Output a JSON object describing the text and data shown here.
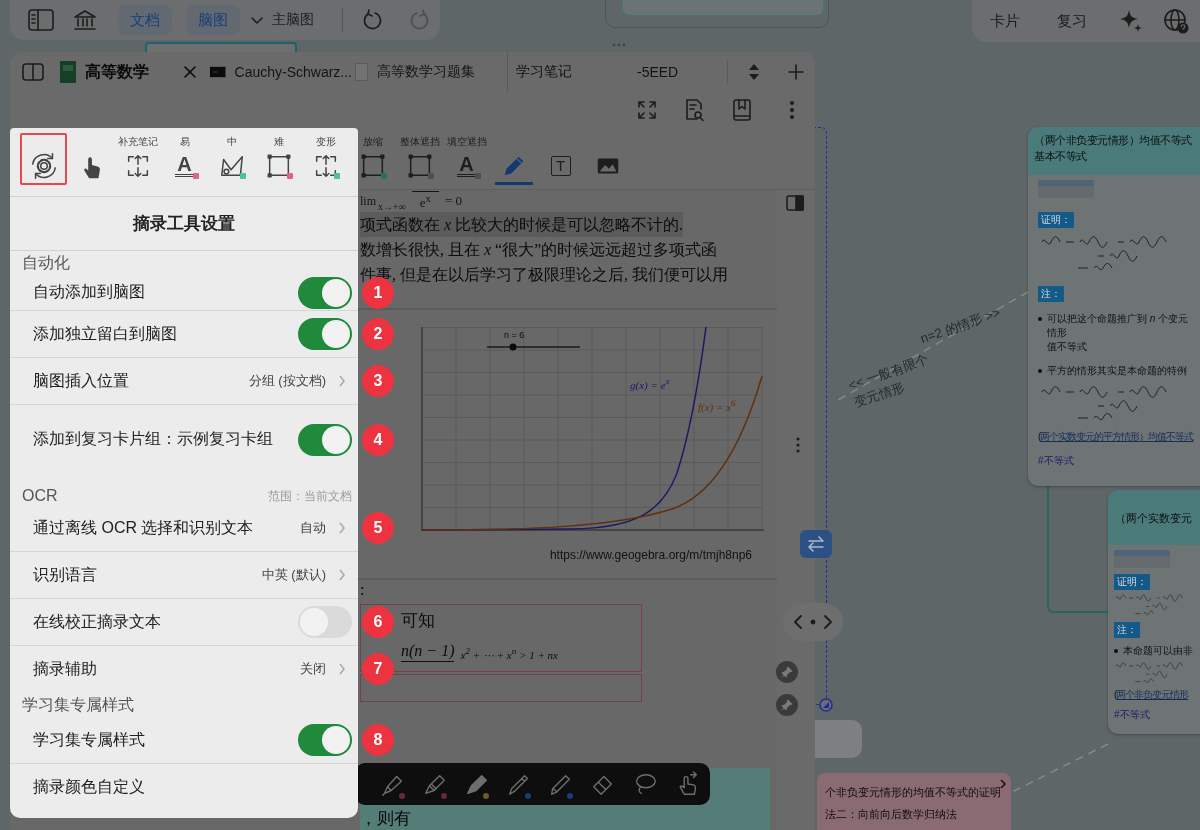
{
  "top_toolbar": {
    "view_buttons": [
      {
        "label": "文档",
        "selected": true
      },
      {
        "label": "脑图",
        "selected": true
      }
    ],
    "mindmap_dropdown": "主脑图",
    "undo": {
      "disabled": false
    },
    "redo": {
      "disabled": true
    }
  },
  "right_toolbar": {
    "buttons": [
      "卡片",
      "复习"
    ]
  },
  "doc_window": {
    "tabs": [
      {
        "label": "高等数学",
        "selected": true,
        "kind": "book"
      },
      {
        "label": "Cauchy-Schwarz...",
        "selected": false,
        "kind": "dark-page"
      },
      {
        "label": "高等数学习题集",
        "selected": false,
        "kind": "blank-page"
      },
      {
        "label": "学习笔记",
        "selected": false,
        "kind": "plain"
      },
      {
        "label": "-5EED",
        "selected": false,
        "kind": "plain"
      }
    ],
    "tools": [
      {
        "kind": "cycle-gear",
        "dimmed": false,
        "selected": false,
        "outlined": true
      },
      {
        "kind": "hand",
        "dimmed": false,
        "selected": false,
        "outlined": false
      },
      {
        "label": "补充笔记",
        "kind": "frame-arrows",
        "dimmed": false,
        "selected": false,
        "outlined": false
      },
      {
        "label": "易",
        "kind": "letter",
        "glyph": "A",
        "color": "#e2657f",
        "dimmed": false,
        "selected": false,
        "outlined": false
      },
      {
        "label": "中",
        "kind": "polygon",
        "color": "#4bbfa8",
        "dimmed": false,
        "selected": false,
        "outlined": false
      },
      {
        "label": "难",
        "kind": "rect-frame",
        "color": "#e2657f",
        "dimmed": false,
        "selected": false,
        "outlined": false
      },
      {
        "label": "变形",
        "kind": "frame-arrows",
        "color": "#4bbfa8",
        "dimmed": false,
        "selected": false,
        "outlined": false
      },
      {
        "label": "放缩",
        "kind": "rect-frame",
        "color": "#2f6b5f",
        "dimmed": true,
        "selected": false,
        "outlined": false
      },
      {
        "label": "整体遮挡",
        "kind": "rect-frame",
        "color": "#4f4f4f",
        "dimmed": true,
        "selected": false,
        "outlined": false
      },
      {
        "label": "填空遮挡",
        "kind": "letter",
        "glyph": "A",
        "color": "#4f4f4f",
        "dimmed": true,
        "selected": false,
        "outlined": false
      },
      {
        "kind": "pencil",
        "dimmed": true,
        "selected": true,
        "outlined": false
      },
      {
        "kind": "text-box",
        "glyph": "T",
        "dimmed": true,
        "selected": false,
        "outlined": false
      },
      {
        "kind": "image",
        "dimmed": true,
        "selected": false,
        "outlined": false
      }
    ],
    "page": {
      "formula": {
        "operator": "lim",
        "subscript": "x→+∞",
        "denominator": "e$^{x}$",
        "result": "= 0"
      },
      "lines": [
        {
          "text": "项式函数在 *x* 比较大的时候是可以忽略不计的.",
          "highlighted": true
        },
        {
          "text": "数增长很快, 且在 *x* “很大”的时候远远超过多项式函",
          "highlighted": false
        },
        {
          "text": "件事, 但是在以后学习了极限理论之后, 我们便可以用",
          "highlighted": false
        }
      ],
      "figure": {
        "slider_label": "n = 6",
        "curves": [
          {
            "label": "g(x) = e$^{x}$",
            "color": "#1c1868"
          },
          {
            "label": "f(x) = x$^{6}$",
            "color": "#5e3210"
          }
        ],
        "caption": "https://www.geogebra.org/m/tmjh8np6"
      },
      "proof_heading": ":",
      "framed_text": "可知",
      "formula_numerator": "n(n − 1)",
      "formula_rest": "x$^{2}$ + ⋯ + x$^{n}$ > 1 + nx",
      "bottom_excerpt": "，则有"
    },
    "draw_tools": [
      {
        "kind": "highlighter",
        "color": "#6b2a33"
      },
      {
        "kind": "highlighter-outline",
        "color": "#6b2a33"
      },
      {
        "kind": "marker",
        "color": "#6b5c24"
      },
      {
        "kind": "pen",
        "color": "#1c3a7a"
      },
      {
        "kind": "pen-outline",
        "color": "#1c3a7a"
      },
      {
        "kind": "eraser"
      },
      {
        "kind": "lasso"
      },
      {
        "kind": "touch"
      }
    ]
  },
  "settings_popup": {
    "title": "摘录工具设置",
    "sections": [
      {
        "title": "自动化",
        "rows": [
          {
            "kind": "toggle",
            "label": "自动添加到脑图",
            "on": true,
            "badge": "1"
          },
          {
            "kind": "toggle",
            "label": "添加独立留白到脑图",
            "on": true,
            "badge": "2"
          },
          {
            "kind": "choice",
            "label": "脑图插入位置",
            "value": "分组 (按文档)",
            "badge": "3"
          },
          {
            "kind": "toggle",
            "label": "添加到复习卡片组：示例复习卡组",
            "on": true,
            "badge": "4"
          }
        ]
      },
      {
        "title": "OCR",
        "note": "范围：当前文档",
        "rows": [
          {
            "kind": "choice",
            "label": "通过离线 OCR 选择和识别文本",
            "value": "自动",
            "badge": "5"
          },
          {
            "kind": "choice",
            "label": "识别语言",
            "value": "中英 (默认)"
          },
          {
            "kind": "toggle",
            "label": "在线校正摘录文本",
            "on": false,
            "badge": "6"
          },
          {
            "kind": "choice",
            "label": "摘录辅助",
            "value": "关闭",
            "badge": "7"
          }
        ]
      },
      {
        "title": "学习集专属样式",
        "rows": [
          {
            "kind": "toggle",
            "label": "学习集专属样式",
            "on": true,
            "badge": "8"
          },
          {
            "kind": "link",
            "label": "摘录颜色自定义"
          }
        ]
      }
    ]
  },
  "mindmap": {
    "nodes": [
      {
        "kind": "card",
        "title_lines": [
          "（两个非负变元情形）均值不等式",
          "基本不等式"
        ],
        "body": [
          {
            "kind": "thumbnail"
          },
          {
            "kind": "tag",
            "text": "证明："
          },
          {
            "kind": "handwriting"
          },
          {
            "kind": "tag",
            "text": "注："
          },
          {
            "kind": "bullet",
            "lines": [
              "可以把这个命题推广到 *n* 个变元情形",
              "值不等式"
            ]
          },
          {
            "kind": "bullet",
            "lines": [
              "平方的情形其实是本命题的特例"
            ]
          },
          {
            "kind": "handwriting"
          },
          {
            "kind": "link",
            "prefix": "(",
            "text": "两个实数变元的平方情形）均值不等式"
          },
          {
            "kind": "hashtag",
            "text": "#不等式"
          }
        ]
      },
      {
        "kind": "card",
        "title_lines": [
          "（两个实数变元"
        ],
        "body": [
          {
            "kind": "thumbnail"
          },
          {
            "kind": "tag",
            "text": "证明："
          },
          {
            "kind": "handwriting"
          },
          {
            "kind": "tag",
            "text": "注："
          },
          {
            "kind": "bullet",
            "lines": [
              "本命题可以由非"
            ]
          },
          {
            "kind": "handwriting"
          },
          {
            "kind": "link",
            "prefix": "(",
            "text": "两个非负变元情形"
          },
          {
            "kind": "hashtag",
            "text": "#不等式"
          }
        ]
      }
    ],
    "edge_labels": [
      {
        "lines": [
          "n=2 的情形 >>"
        ]
      },
      {
        "lines": [
          "<< 一般有限个",
          "变元情形"
        ]
      }
    ],
    "proof_node": {
      "lines": [
        "个非负变元情形的均值不等式的证明",
        "法二：向前向后数学归纳法"
      ]
    }
  }
}
